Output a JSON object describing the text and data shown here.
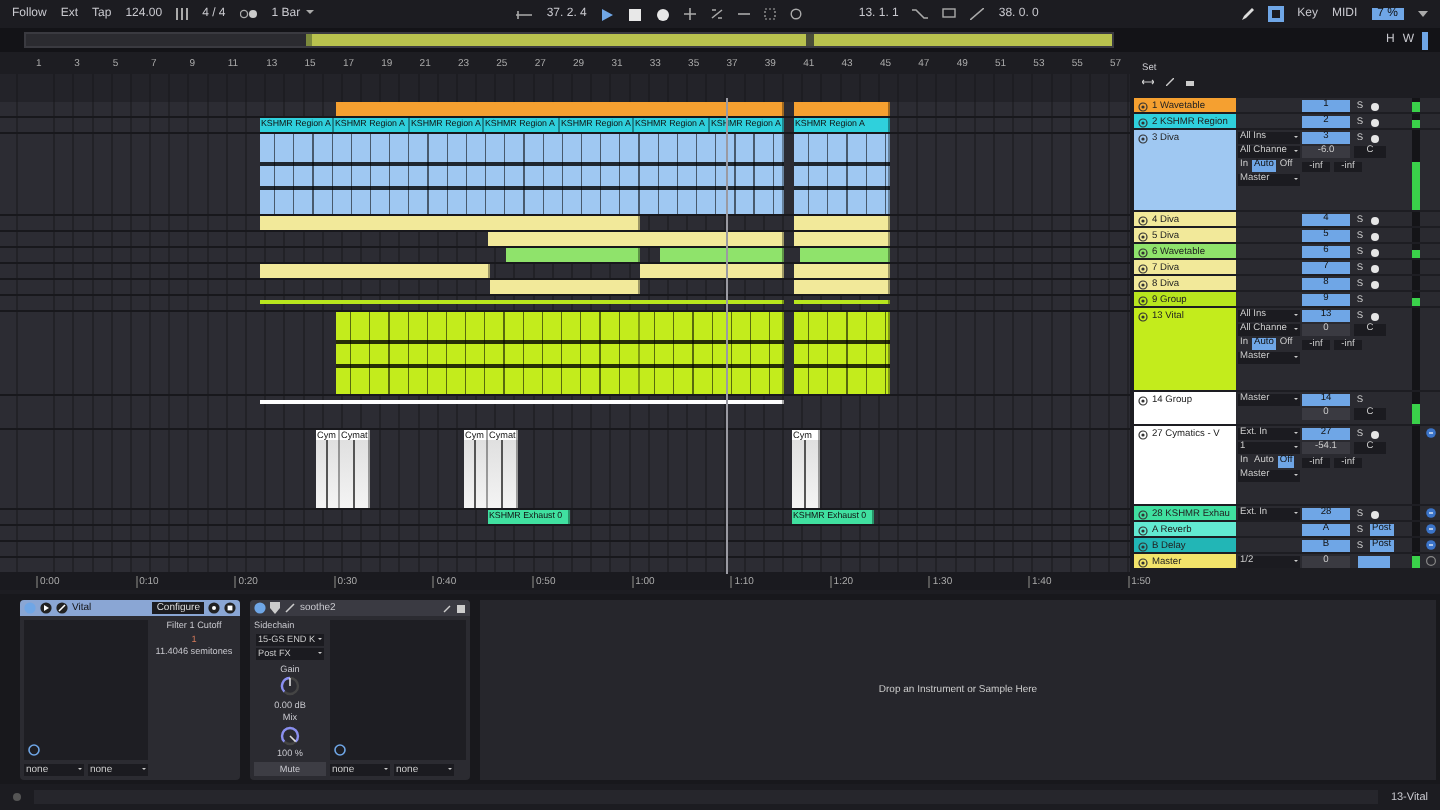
{
  "transport": {
    "follow": "Follow",
    "ext": "Ext",
    "tap": "Tap",
    "tempo": "124.00",
    "signature": "4 / 4",
    "quantize": "1 Bar",
    "position": "37. 2. 4",
    "loop_start": "13. 1. 1",
    "loop_length": "38. 0. 0",
    "key": "Key",
    "midi": "MIDI",
    "cpu": "7 %"
  },
  "overview": {
    "buttons": [
      "H",
      "W"
    ]
  },
  "ruler": {
    "bars": [
      "1",
      "3",
      "5",
      "7",
      "9",
      "11",
      "13",
      "15",
      "17",
      "19",
      "21",
      "23",
      "25",
      "27",
      "29",
      "31",
      "33",
      "35",
      "37",
      "39",
      "41",
      "43",
      "45",
      "47",
      "49",
      "51",
      "53",
      "55",
      "57"
    ]
  },
  "set_label": "Set",
  "tracks": [
    {
      "name": "1 Wavetable",
      "kind": "instrument",
      "color": "#f5a030",
      "number": "1",
      "solo": "S",
      "meter": {
        "level": 0.7
      }
    },
    {
      "name": "2 KSHMR Region",
      "kind": "instrument",
      "color": "#2fd0dc",
      "number": "2",
      "solo": "S",
      "meter": {
        "level": 0.6
      },
      "clips": [
        {
          "name": "KSHMR Region A"
        },
        {
          "name": "KSHMR Region A"
        },
        {
          "name": "KSHMR Region A"
        },
        {
          "name": "KSHMR Region A"
        },
        {
          "name": "KSHMR Region A"
        },
        {
          "name": "KSHMR Region A"
        },
        {
          "name": "KSHMR Region A"
        },
        {
          "name": "KSHMR Region A"
        }
      ]
    },
    {
      "name": "3 Diva",
      "kind": "instrument",
      "color": "#9fc8f2",
      "number": "3",
      "solo": "S",
      "io": [
        {
          "kind": "dropdown",
          "value": "All Ins"
        },
        {
          "kind": "dropdown",
          "value": "All Channe"
        },
        {
          "kind": "monitor",
          "options": [
            {
              "label": "In",
              "selected": false
            },
            {
              "label": "Auto",
              "selected": true
            },
            {
              "label": "Off",
              "selected": false
            }
          ]
        },
        {
          "kind": "dropdown",
          "value": "Master"
        }
      ],
      "volume": "-6.0",
      "pan": "C",
      "peaks": [
        "-inf",
        "-inf"
      ],
      "meter": {
        "level": 0.6
      }
    },
    {
      "name": "4 Diva",
      "kind": "instrument",
      "color": "#f2e99a",
      "number": "4",
      "solo": "S"
    },
    {
      "name": "5 Diva",
      "kind": "instrument",
      "color": "#f2e99a",
      "number": "5",
      "solo": "S"
    },
    {
      "name": "6 Wavetable",
      "kind": "instrument",
      "color": "#8fe36b",
      "number": "6",
      "solo": "S",
      "meter": {
        "level": 0.6
      }
    },
    {
      "name": "7 Diva",
      "kind": "instrument",
      "color": "#f2e99a",
      "number": "7",
      "solo": "S"
    },
    {
      "name": "8 Diva",
      "kind": "instrument",
      "color": "#f2e99a",
      "number": "8",
      "solo": "S"
    },
    {
      "name": "9 Group",
      "kind": "group",
      "color": "#b8e61e",
      "number": "9",
      "solo": "S",
      "meter": {
        "level": 0.6
      }
    },
    {
      "name": "13 Vital",
      "kind": "instrument",
      "color": "#c3ec1c",
      "number": "13",
      "solo": "S",
      "io": [
        {
          "kind": "dropdown",
          "value": "All Ins"
        },
        {
          "kind": "dropdown",
          "value": "All Channe"
        },
        {
          "kind": "monitor",
          "options": [
            {
              "label": "In",
              "selected": false
            },
            {
              "label": "Auto",
              "selected": true
            },
            {
              "label": "Off",
              "selected": false
            }
          ]
        },
        {
          "kind": "dropdown",
          "value": "Master"
        }
      ],
      "volume": "0",
      "pan": "C",
      "peaks": [
        "-inf",
        "-inf"
      ]
    },
    {
      "name": "14 Group",
      "kind": "group",
      "color": "#ffffff",
      "number": "14",
      "solo": "S",
      "io": [
        {
          "kind": "dropdown",
          "value": "Master"
        }
      ],
      "volume": "0",
      "pan": "C",
      "meter": {
        "level": 0.6
      }
    },
    {
      "name": "27 Cymatics - V",
      "kind": "audio",
      "color": "#ffffff",
      "number": "27",
      "solo": "S",
      "io": [
        {
          "kind": "dropdown",
          "value": "Ext. In"
        },
        {
          "kind": "dropdown",
          "value": "1"
        },
        {
          "kind": "monitor",
          "options": [
            {
              "label": "In",
              "selected": false
            },
            {
              "label": "Auto",
              "selected": false
            },
            {
              "label": "Off",
              "selected": true
            }
          ]
        },
        {
          "kind": "dropdown",
          "value": "Master"
        }
      ],
      "volume": "-54.1",
      "pan": "C",
      "peaks": [
        "-inf",
        "-inf"
      ],
      "clips": [
        {
          "name": "Cym"
        },
        {
          "name": "Cymat"
        },
        {
          "name": "Cym"
        },
        {
          "name": "Cymat"
        },
        {
          "name": "Cym"
        }
      ]
    },
    {
      "name": "28 KSHMR Exhau",
      "kind": "audio",
      "color": "#40e0a0",
      "number": "28",
      "solo": "S",
      "io": [
        {
          "kind": "dropdown",
          "value": "Ext. In"
        }
      ],
      "clips": [
        {
          "name": "KSHMR Exhaust 0"
        },
        {
          "name": "KSHMR Exhaust 0"
        }
      ]
    },
    {
      "name": "A Reverb",
      "kind": "return",
      "color": "#62ead2",
      "number": "A",
      "solo": "S",
      "send": "Post"
    },
    {
      "name": "B Delay",
      "kind": "return",
      "color": "#22b6b6",
      "number": "B",
      "solo": "S",
      "send": "Post"
    },
    {
      "name": "Master",
      "kind": "master",
      "color": "#f2e36a",
      "io": [
        {
          "kind": "dropdown",
          "value": "1/2"
        }
      ],
      "volume": "0",
      "meter": {
        "level": 0.8
      }
    }
  ],
  "time_ruler": [
    "0:00",
    "0:10",
    "0:20",
    "0:30",
    "0:40",
    "0:50",
    "1:00",
    "1:10",
    "1:20",
    "1:30",
    "1:40",
    "1:50"
  ],
  "devices": [
    {
      "kind": "instrument",
      "title": "Vital",
      "configure": "Configure",
      "param_name": "Filter 1 Cutoff",
      "param_index": "1",
      "param_value": "11.4046 semitones",
      "selectors": [
        "none",
        "none"
      ]
    },
    {
      "kind": "effect",
      "title": "soothe2",
      "sidechain_label": "Sidechain",
      "sidechain": "15-GS END K",
      "tap": "Post FX",
      "gain_label": "Gain",
      "gain": "0.00 dB",
      "gain_knob": {
        "level": 0.5
      },
      "mix_label": "Mix",
      "mix": "100 %",
      "mix_knob": {
        "level": 1
      },
      "mute": "Mute",
      "selectors": [
        "none",
        "none"
      ]
    }
  ],
  "drop_zone": "Drop an Instrument or Sample Here",
  "status_bar": {
    "text": "13-Vital"
  }
}
